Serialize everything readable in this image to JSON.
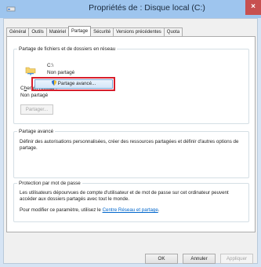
{
  "window": {
    "title": "Propriétés de : Disque local (C:)",
    "close_glyph": "×"
  },
  "tabs": [
    {
      "label": "Général",
      "active": false
    },
    {
      "label": "Outils",
      "active": false
    },
    {
      "label": "Matériel",
      "active": false
    },
    {
      "label": "Partage",
      "active": true
    },
    {
      "label": "Sécurité",
      "active": false
    },
    {
      "label": "Versions précédentes",
      "active": false
    },
    {
      "label": "Quota",
      "active": false
    }
  ],
  "network_sharing": {
    "group_title": "Partage de fichiers et de dossiers en réseau",
    "icon": "folder-network-icon",
    "path": "C:\\",
    "status": "Non partagé",
    "network_path_label_prefix": "C",
    "network_path_label_underlined": "h",
    "network_path_label_rest": "emin réseau :",
    "network_path_value": "Non partagé",
    "share_button": "Partager..."
  },
  "advanced_sharing": {
    "group_title": "Partage avancé",
    "description": "Définir des autorisations personnalisées, créer des ressources partagées et définir d'autres options de partage.",
    "button": "Partage avancé...",
    "button_icon": "uac-shield-icon",
    "highlight_color": "#d71e2c"
  },
  "password_protection": {
    "group_title": "Protection par mot de passe",
    "description": "Les utilisateurs dépourvues de compte d'utilisateur et de mot de passe sur cet ordinateur peuvent accéder aux dossiers partagés avec tout le monde.",
    "modify_prefix": "Pour modifier ce paramètre, utilisez le ",
    "link_text": "Centre Réseau et partage",
    "modify_suffix": "."
  },
  "footer": {
    "ok": "OK",
    "cancel": "Annuler",
    "apply": "Appliquer"
  }
}
